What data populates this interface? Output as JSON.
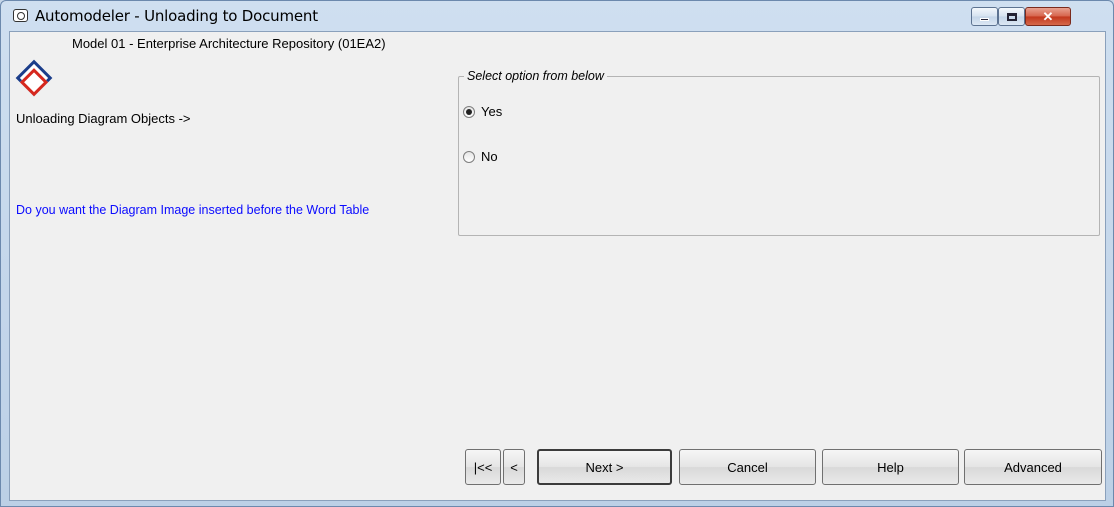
{
  "window": {
    "title": "Automodeler - Unloading to Document",
    "controls": {
      "minimize_icon": "minimize-icon",
      "maximize_icon": "maximize-icon",
      "close_glyph": "✕"
    }
  },
  "header": {
    "model_name": "Model 01 - Enterprise Architecture Repository (01EA2)",
    "logo_icon": "automodeler-logo-icon"
  },
  "left_panel": {
    "step_label": "Unloading Diagram Objects ->",
    "question": "Do you want the Diagram Image inserted before the Word Table",
    "question_color": "#0b0bff"
  },
  "options": {
    "legend": "Select option from below",
    "items": [
      {
        "label": "Yes",
        "checked": true
      },
      {
        "label": "No",
        "checked": false
      }
    ]
  },
  "buttons": {
    "first": "|<<",
    "prev": "<",
    "next": "Next >",
    "cancel": "Cancel",
    "help": "Help",
    "advanced": "Advanced"
  }
}
